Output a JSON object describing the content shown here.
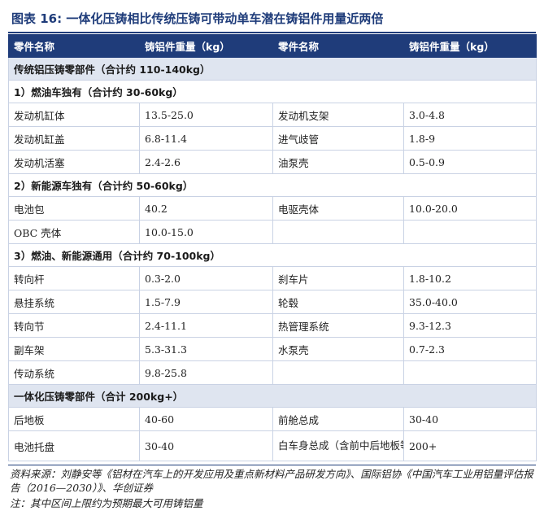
{
  "title": "图表 16:   一体化压铸相比传统压铸可带动单车潜在铸铝件用量近两倍",
  "header": {
    "col1": "零件名称",
    "col2": "铸铝件重量（kg）",
    "col3": "零件名称",
    "col4": "铸铝件重量（kg）"
  },
  "sections": {
    "traditional": "传统铝压铸零部件（合计约 110-140kg）",
    "fuel_only": "1）燃油车独有（合计约 30-60kg）",
    "nev_only": "2）新能源车独有（合计约 50-60kg）",
    "common": "3）燃油、新能源通用（合计约 70-100kg）",
    "integrated": "一体化压铸零部件（合计 200kg+）"
  },
  "fuel_rows": [
    {
      "p1": "发动机缸体",
      "w1": "13.5-25.0",
      "p2": "发动机支架",
      "w2": "3.0-4.8"
    },
    {
      "p1": "发动机缸盖",
      "w1": "6.8-11.4",
      "p2": "进气歧管",
      "w2": "1.8-9"
    },
    {
      "p1": "发动机活塞",
      "w1": "2.4-2.6",
      "p2": "油泵壳",
      "w2": "0.5-0.9"
    }
  ],
  "nev_rows": [
    {
      "p1": "电池包",
      "w1": "40.2",
      "p2": "电驱壳体",
      "w2": "10.0-20.0"
    },
    {
      "p1": "OBC 壳体",
      "w1": "10.0-15.0",
      "p2": "",
      "w2": ""
    }
  ],
  "common_rows": [
    {
      "p1": "转向杆",
      "w1": "0.3-2.0",
      "p2": "刹车片",
      "w2": "1.8-10.2"
    },
    {
      "p1": "悬挂系统",
      "w1": "1.5-7.9",
      "p2": "轮毂",
      "w2": "35.0-40.0"
    },
    {
      "p1": "转向节",
      "w1": "2.4-11.1",
      "p2": "热管理系统",
      "w2": "9.3-12.3"
    },
    {
      "p1": "副车架",
      "w1": "5.3-31.3",
      "p2": "水泵壳",
      "w2": "0.7-2.3"
    },
    {
      "p1": "传动系统",
      "w1": "9.8-25.8",
      "p2": "",
      "w2": ""
    }
  ],
  "integrated_rows": [
    {
      "p1": "后地板",
      "w1": "40-60",
      "p2": "前舱总成",
      "w2": "30-40"
    },
    {
      "p1": "电池托盘",
      "w1": "30-40",
      "p2": "白车身总成（含前中后地板等结构件）",
      "w2": "200+"
    }
  ],
  "source": "资料来源：刘静安等《铝材在汽车上的开发应用及重点新材料产品研发方向》、国际铝协《中国汽车工业用铝量评估报告（2016—2030）》、华创证券",
  "note": "注：其中区间上限约为预期最大可用铸铝量"
}
